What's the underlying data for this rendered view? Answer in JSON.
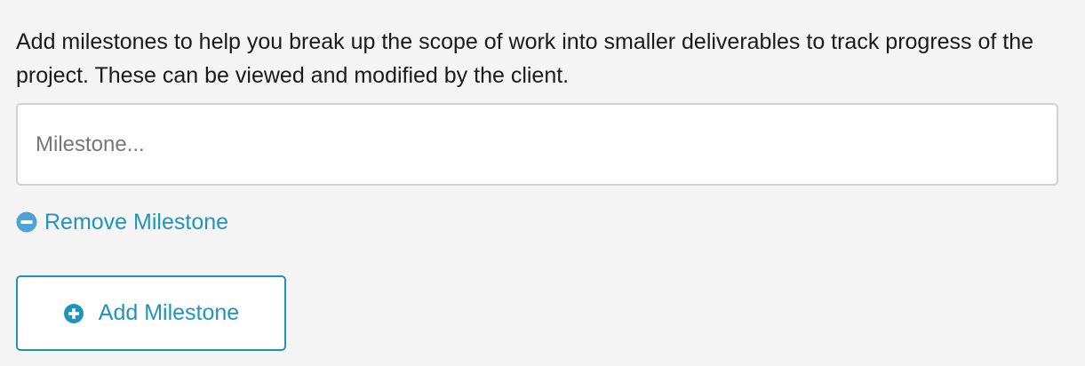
{
  "description": "Add milestones to help you break up the scope of work into smaller deliverables to track progress of the project. These can be viewed and modified by the client.",
  "milestone_input": {
    "placeholder": "Milestone...",
    "value": ""
  },
  "remove_milestone": {
    "label": "Remove Milestone",
    "icon": "minus-circle-icon"
  },
  "add_milestone": {
    "label": "Add Milestone",
    "icon": "plus-circle-icon"
  },
  "colors": {
    "accent": "#1f95bd",
    "remove_icon": "#4da3d6",
    "background": "#f5f5f5"
  }
}
